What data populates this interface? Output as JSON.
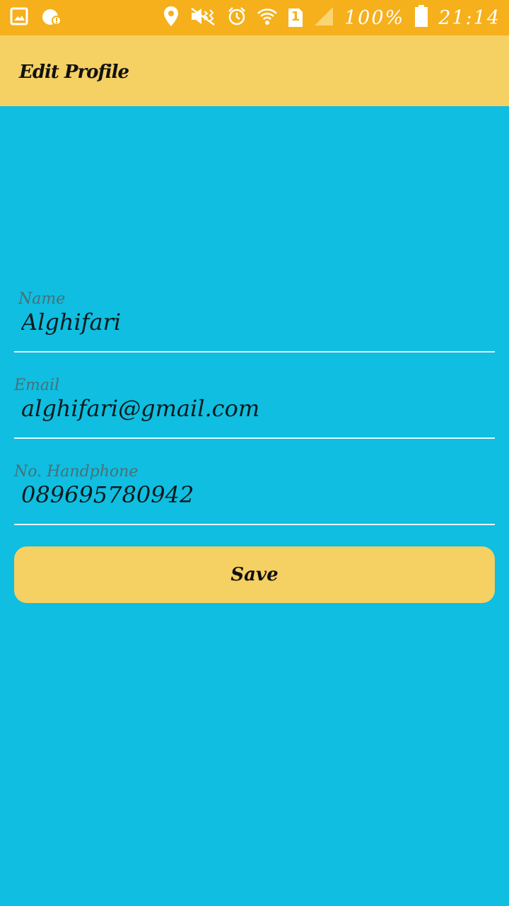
{
  "status_bar": {
    "battery": "100%",
    "time": "21:14",
    "sim_slot": "1",
    "icons": [
      "gallery-icon",
      "notification-icon",
      "location-icon",
      "vibrate-icon",
      "alarm-icon",
      "wifi-icon",
      "sim-icon",
      "signal-icon",
      "battery-icon"
    ]
  },
  "app_bar": {
    "title": "Edit Profile"
  },
  "form": {
    "name": {
      "label": "Name",
      "value": "Alghifari"
    },
    "email": {
      "label": "Email",
      "value": "alghifari@gmail.com"
    },
    "phone": {
      "label": "No. Handphone",
      "value": "089695780942"
    }
  },
  "actions": {
    "save_label": "Save"
  },
  "colors": {
    "status_bar": "#f5b01c",
    "app_bar": "#f5d062",
    "background": "#0fbee0",
    "button": "#f5d062"
  }
}
